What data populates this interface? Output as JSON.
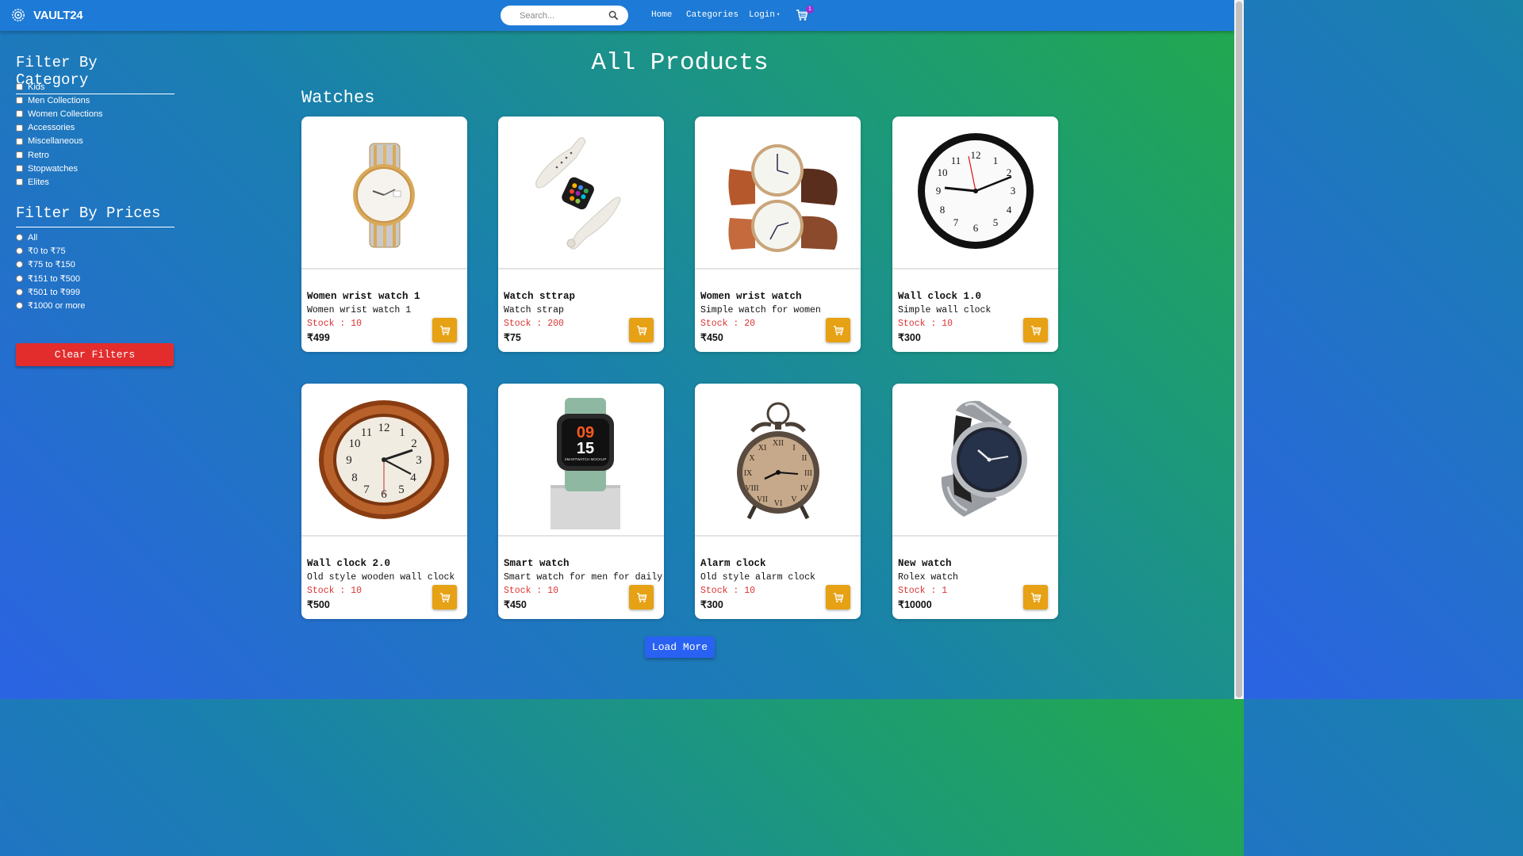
{
  "header": {
    "brand": "VAULT24",
    "search_placeholder": "Search...",
    "nav": [
      "Home",
      "Categories",
      "Login"
    ],
    "cart_count": "1"
  },
  "sidebar": {
    "category_title": "Filter By Category",
    "categories": [
      "Kids",
      "Men Collections",
      "Women Collections",
      "Accessories",
      "Miscellaneous",
      "Retro",
      "Stopwatches",
      "Elites"
    ],
    "price_title": "Filter By Prices",
    "prices": [
      "All",
      "₹0 to ₹75",
      "₹75 to ₹150",
      "₹151 to ₹500",
      "₹501 to ₹999",
      "₹1000 or more"
    ],
    "clear_label": "Clear Filters"
  },
  "main": {
    "title": "All Products",
    "section": "Watches",
    "load_more": "Load More",
    "products": [
      {
        "name": "Women wrist watch 1",
        "desc": "Women wrist watch 1",
        "stock": "Stock : 10",
        "price": "₹499",
        "image": "gold-silver-wristwatch"
      },
      {
        "name": "Watch sttrap",
        "desc": "Watch strap",
        "stock": "Stock : 200",
        "price": "₹75",
        "image": "white-watch-strap"
      },
      {
        "name": "Women wrist watch",
        "desc": "Simple watch for women",
        "stock": "Stock : 20",
        "price": "₹450",
        "image": "brown-leather-watch"
      },
      {
        "name": "Wall clock 1.0",
        "desc": "Simple wall clock",
        "stock": "Stock : 10",
        "price": "₹300",
        "image": "black-wall-clock"
      },
      {
        "name": "Wall clock 2.0",
        "desc": "Old style wooden wall clock",
        "stock": "Stock : 10",
        "price": "₹500",
        "image": "wooden-wall-clock"
      },
      {
        "name": "Smart watch",
        "desc": "Smart watch for men for daily",
        "stock": "Stock : 10",
        "price": "₹450",
        "image": "smart-watch"
      },
      {
        "name": "Alarm clock",
        "desc": "Old style alarm clock",
        "stock": "Stock : 10",
        "price": "₹300",
        "image": "alarm-clock"
      },
      {
        "name": "New watch",
        "desc": "Rolex watch",
        "stock": "Stock : 1",
        "price": "₹10000",
        "image": "steel-wristwatch"
      }
    ],
    "smartwatch_face": {
      "hour": "09",
      "minute": "15",
      "caption": "SMARTWATCH MOCKUP"
    }
  },
  "colors": {
    "topbar": "#1d7ad6",
    "add_button": "#e6a114",
    "clear_button": "#e32d2d",
    "load_more": "#2962f2",
    "stock": "#dd3333"
  }
}
